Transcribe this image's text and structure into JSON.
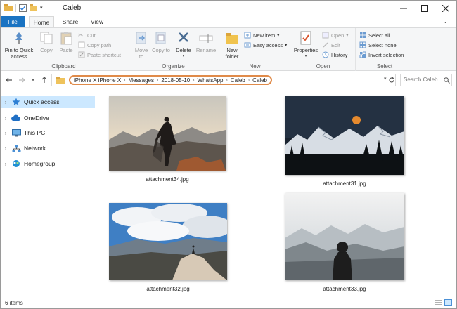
{
  "window": {
    "title": "Caleb"
  },
  "ribbon_tabs": [
    "File",
    "Home",
    "Share",
    "View"
  ],
  "ribbon": {
    "clipboard": {
      "label": "Clipboard",
      "pin": "Pin to Quick access",
      "copy": "Copy",
      "paste": "Paste",
      "cut": "Cut",
      "copy_path": "Copy path",
      "paste_shortcut": "Paste shortcut"
    },
    "organize": {
      "label": "Organize",
      "move_to": "Move to",
      "copy_to": "Copy to",
      "delete": "Delete",
      "rename": "Rename"
    },
    "new": {
      "label": "New",
      "new_folder": "New folder",
      "new_item": "New item",
      "easy_access": "Easy access"
    },
    "open": {
      "label": "Open",
      "properties": "Properties",
      "open": "Open",
      "edit": "Edit",
      "history": "History"
    },
    "select": {
      "label": "Select",
      "select_all": "Select all",
      "select_none": "Select none",
      "invert_selection": "Invert selection"
    }
  },
  "address": {
    "crumbs": [
      "iPhone X iPhone X",
      "Messages",
      "2018-05-10",
      "WhatsApp",
      "Caleb",
      "Caleb"
    ]
  },
  "search": {
    "placeholder": "Search Caleb"
  },
  "sidebar": {
    "items": [
      {
        "label": "Quick access",
        "icon": "star-icon",
        "selected": true
      },
      {
        "label": "OneDrive",
        "icon": "cloud-icon",
        "selected": false
      },
      {
        "label": "This PC",
        "icon": "computer-icon",
        "selected": false
      },
      {
        "label": "Network",
        "icon": "network-icon",
        "selected": false
      },
      {
        "label": "Homegroup",
        "icon": "homegroup-icon",
        "selected": false
      }
    ]
  },
  "files": [
    {
      "name": "attachment34.jpg"
    },
    {
      "name": "attachment31.jpg"
    },
    {
      "name": "attachment32.jpg"
    },
    {
      "name": "attachment33.jpg"
    }
  ],
  "status": {
    "count": "6 items"
  },
  "colors": {
    "accent": "#1a73c2",
    "selection": "#cce8ff",
    "highlight_ring": "#e08b4a"
  }
}
